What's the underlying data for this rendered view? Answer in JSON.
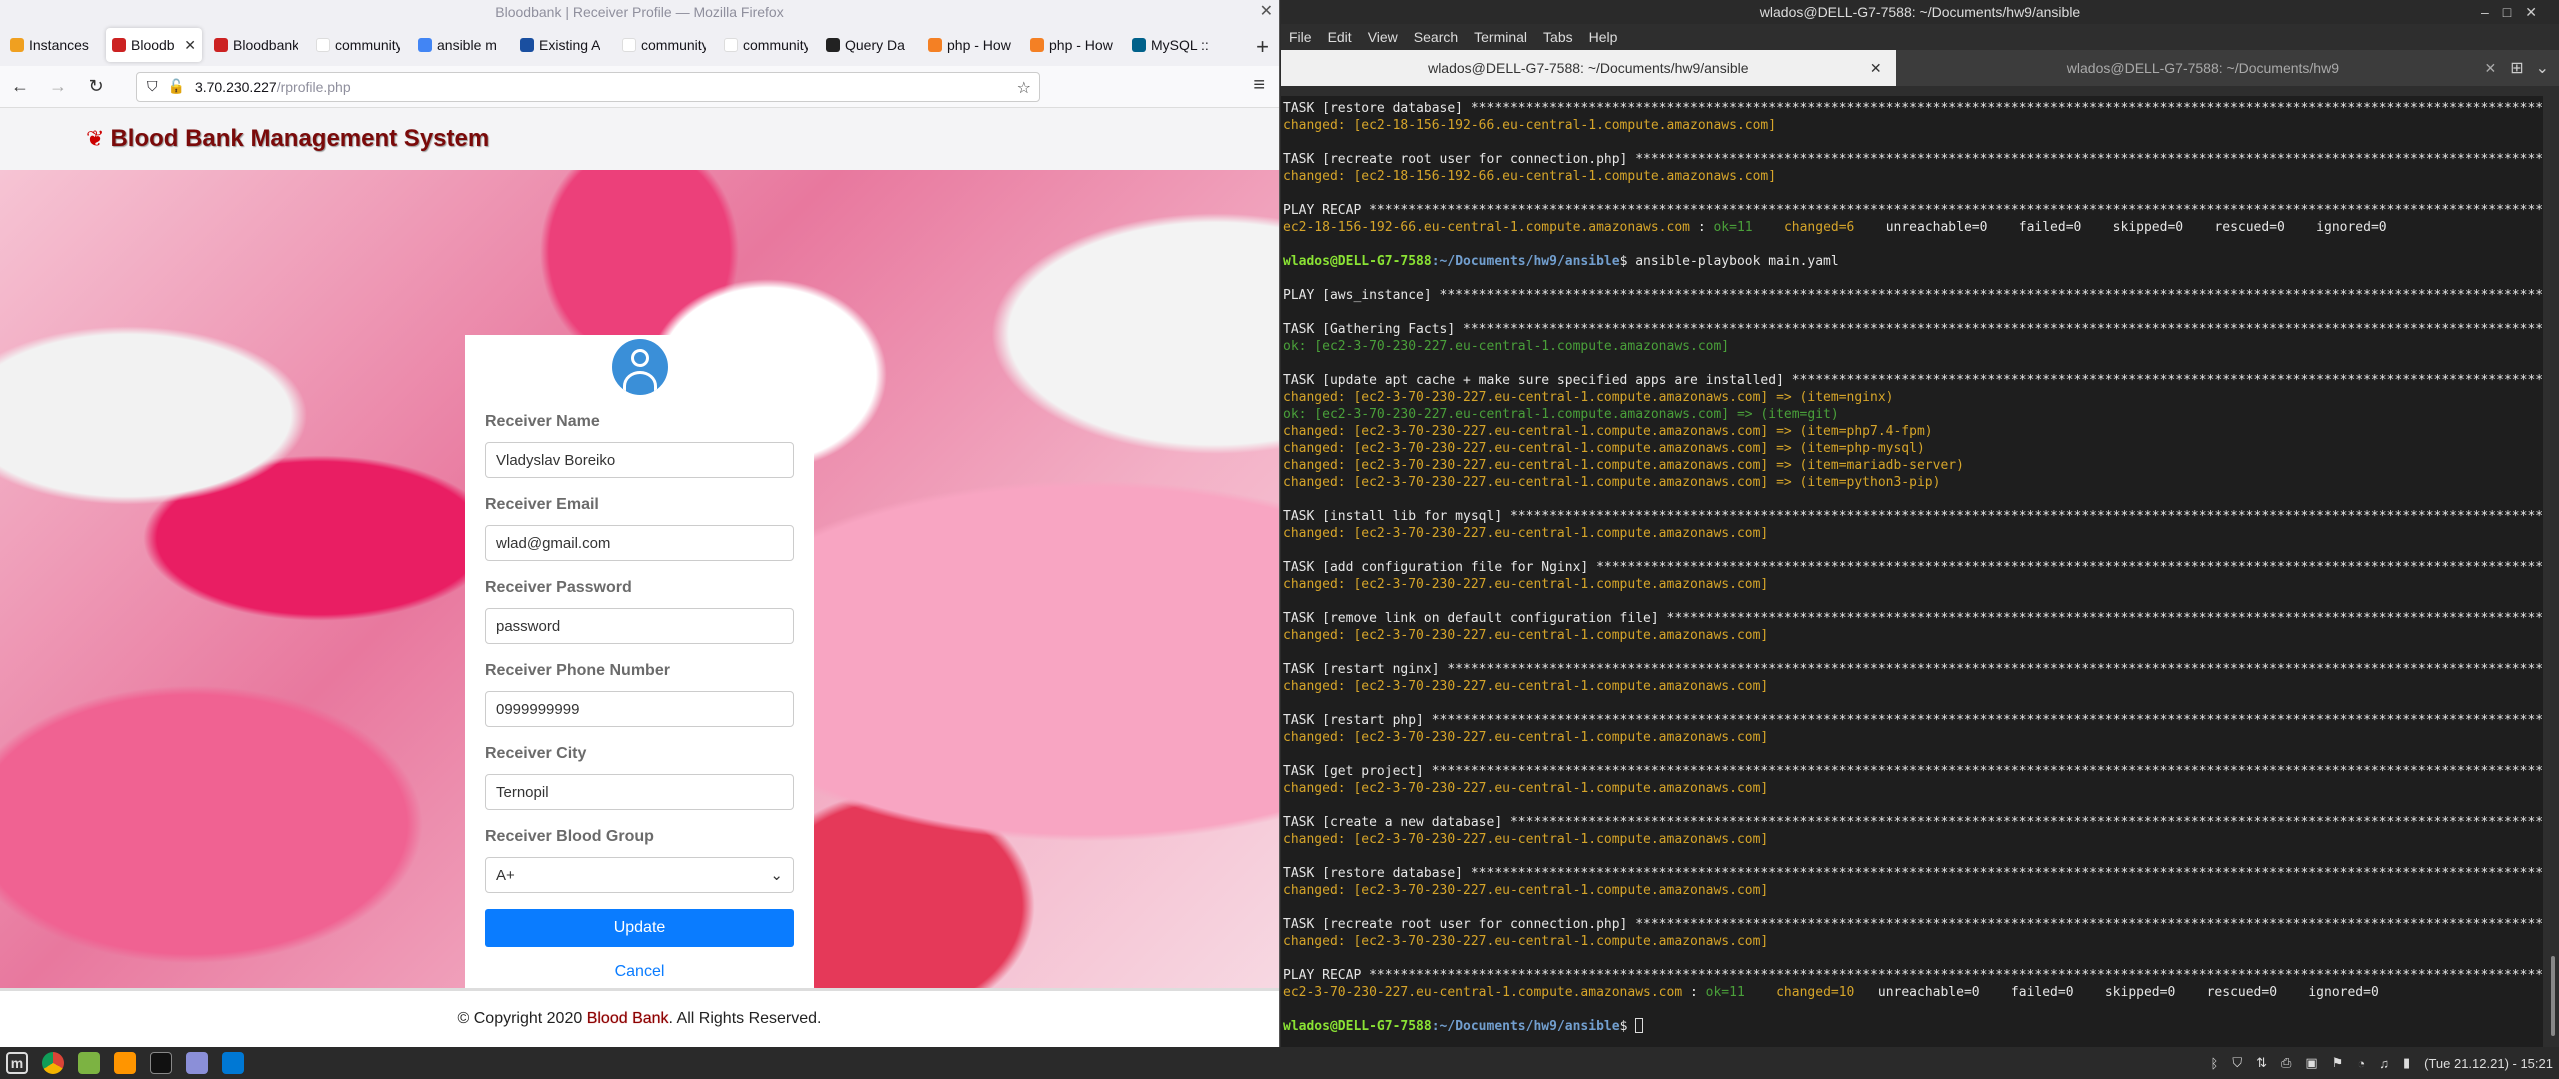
{
  "firefox": {
    "window_title": "Bloodbank | Receiver Profile — Mozilla Firefox",
    "tabs": [
      {
        "label": "Instances",
        "color": "#f0a020"
      },
      {
        "label": "Bloodb",
        "color": "#cc2222",
        "active": true
      },
      {
        "label": "Bloodbank",
        "color": "#cc2222"
      },
      {
        "label": "community.m",
        "color": "#ffffff"
      },
      {
        "label": "ansible m",
        "color": "#4285f4"
      },
      {
        "label": "Existing A",
        "color": "#1a4fa0"
      },
      {
        "label": "community.m",
        "color": "#ffffff"
      },
      {
        "label": "community.m",
        "color": "#ffffff"
      },
      {
        "label": "Query Da",
        "color": "#222222"
      },
      {
        "label": "php - How",
        "color": "#f48024"
      },
      {
        "label": "php - How",
        "color": "#f48024"
      },
      {
        "label": "MySQL :: ",
        "color": "#00618a"
      }
    ],
    "url_host": "3.70.230.227",
    "url_path": "/rprofile.php"
  },
  "site": {
    "title": "Blood Bank Management System",
    "form": {
      "fields": [
        {
          "label": "Receiver Name",
          "value": "Vladyslav Boreiko"
        },
        {
          "label": "Receiver Email",
          "value": "wlad@gmail.com"
        },
        {
          "label": "Receiver Password",
          "value": "password"
        },
        {
          "label": "Receiver Phone Number",
          "value": "0999999999"
        },
        {
          "label": "Receiver City",
          "value": "Ternopil"
        }
      ],
      "blood_group_label": "Receiver Blood Group",
      "blood_group_value": "A+",
      "update_label": "Update",
      "cancel_label": "Cancel"
    },
    "footer": {
      "prefix": "© Copyright 2020 ",
      "brand": "Blood Bank",
      "suffix": ". All Rights Reserved."
    }
  },
  "terminal": {
    "window_title": "wlados@DELL-G7-7588: ~/Documents/hw9/ansible",
    "menu": [
      "File",
      "Edit",
      "View",
      "Search",
      "Terminal",
      "Tabs",
      "Help"
    ],
    "tabs": [
      "wlados@DELL-G7-7588: ~/Documents/hw9/ansible",
      "wlados@DELL-G7-7588: ~/Documents/hw9"
    ],
    "lines": [
      {
        "t": "task",
        "s": "TASK [restore database] ******************************************************************************************************************************************************"
      },
      {
        "t": "changed",
        "s": "changed: [ec2-18-156-192-66.eu-central-1.compute.amazonaws.com]"
      },
      {
        "t": "blank",
        "s": ""
      },
      {
        "t": "task",
        "s": "TASK [recreate root user for connection.php] ****************************************************************************************************************************"
      },
      {
        "t": "changed",
        "s": "changed: [ec2-18-156-192-66.eu-central-1.compute.amazonaws.com]"
      },
      {
        "t": "blank",
        "s": ""
      },
      {
        "t": "task",
        "s": "PLAY RECAP *******************************************************************************************************************************************************************"
      },
      {
        "t": "recap1",
        "s": ""
      },
      {
        "t": "blank",
        "s": ""
      },
      {
        "t": "prompt",
        "s": "$ ansible-playbook main.yaml"
      },
      {
        "t": "blank",
        "s": ""
      },
      {
        "t": "task",
        "s": "PLAY [aws_instance] **********************************************************************************************************************************************************"
      },
      {
        "t": "blank",
        "s": ""
      },
      {
        "t": "task",
        "s": "TASK [Gathering Facts] *******************************************************************************************************************************************************"
      },
      {
        "t": "ok",
        "s": "ok: [ec2-3-70-230-227.eu-central-1.compute.amazonaws.com]"
      },
      {
        "t": "blank",
        "s": ""
      },
      {
        "t": "task",
        "s": "TASK [update apt cache + make sure specified apps are installed] *********************************************************************************************************"
      },
      {
        "t": "changed",
        "s": "changed: [ec2-3-70-230-227.eu-central-1.compute.amazonaws.com] => (item=nginx)"
      },
      {
        "t": "ok",
        "s": "ok: [ec2-3-70-230-227.eu-central-1.compute.amazonaws.com] => (item=git)"
      },
      {
        "t": "changed",
        "s": "changed: [ec2-3-70-230-227.eu-central-1.compute.amazonaws.com] => (item=php7.4-fpm)"
      },
      {
        "t": "changed",
        "s": "changed: [ec2-3-70-230-227.eu-central-1.compute.amazonaws.com] => (item=php-mysql)"
      },
      {
        "t": "changed",
        "s": "changed: [ec2-3-70-230-227.eu-central-1.compute.amazonaws.com] => (item=mariadb-server)"
      },
      {
        "t": "changed",
        "s": "changed: [ec2-3-70-230-227.eu-central-1.compute.amazonaws.com] => (item=python3-pip)"
      },
      {
        "t": "blank",
        "s": ""
      },
      {
        "t": "task",
        "s": "TASK [install lib for mysql] *************************************************************************************************************************************************"
      },
      {
        "t": "changed",
        "s": "changed: [ec2-3-70-230-227.eu-central-1.compute.amazonaws.com]"
      },
      {
        "t": "blank",
        "s": ""
      },
      {
        "t": "task",
        "s": "TASK [add configuration file for Nginx] **********************************************************************************************************************************"
      },
      {
        "t": "changed",
        "s": "changed: [ec2-3-70-230-227.eu-central-1.compute.amazonaws.com]"
      },
      {
        "t": "blank",
        "s": ""
      },
      {
        "t": "task",
        "s": "TASK [remove link on default configuration file] *************************************************************************************************************************"
      },
      {
        "t": "changed",
        "s": "changed: [ec2-3-70-230-227.eu-central-1.compute.amazonaws.com]"
      },
      {
        "t": "blank",
        "s": ""
      },
      {
        "t": "task",
        "s": "TASK [restart nginx] *********************************************************************************************************************************************************"
      },
      {
        "t": "changed",
        "s": "changed: [ec2-3-70-230-227.eu-central-1.compute.amazonaws.com]"
      },
      {
        "t": "blank",
        "s": ""
      },
      {
        "t": "task",
        "s": "TASK [restart php] ***********************************************************************************************************************************************************"
      },
      {
        "t": "changed",
        "s": "changed: [ec2-3-70-230-227.eu-central-1.compute.amazonaws.com]"
      },
      {
        "t": "blank",
        "s": ""
      },
      {
        "t": "task",
        "s": "TASK [get project] ***********************************************************************************************************************************************************"
      },
      {
        "t": "changed",
        "s": "changed: [ec2-3-70-230-227.eu-central-1.compute.amazonaws.com]"
      },
      {
        "t": "blank",
        "s": ""
      },
      {
        "t": "task",
        "s": "TASK [create a new database] *************************************************************************************************************************************************"
      },
      {
        "t": "changed",
        "s": "changed: [ec2-3-70-230-227.eu-central-1.compute.amazonaws.com]"
      },
      {
        "t": "blank",
        "s": ""
      },
      {
        "t": "task",
        "s": "TASK [restore database] ******************************************************************************************************************************************************"
      },
      {
        "t": "changed",
        "s": "changed: [ec2-3-70-230-227.eu-central-1.compute.amazonaws.com]"
      },
      {
        "t": "blank",
        "s": ""
      },
      {
        "t": "task",
        "s": "TASK [recreate root user for connection.php] ****************************************************************************************************************************"
      },
      {
        "t": "changed",
        "s": "changed: [ec2-3-70-230-227.eu-central-1.compute.amazonaws.com]"
      },
      {
        "t": "blank",
        "s": ""
      },
      {
        "t": "task",
        "s": "PLAY RECAP *******************************************************************************************************************************************************************"
      },
      {
        "t": "recap2",
        "s": ""
      },
      {
        "t": "blank",
        "s": ""
      },
      {
        "t": "prompt_end",
        "s": "$ "
      }
    ],
    "recap1": {
      "host": "ec2-18-156-192-66.eu-central-1.compute.amazonaws.com",
      "sep": " : ",
      "ok": "ok=11",
      "changed": "changed=6",
      "rest": "    unreachable=0    failed=0    skipped=0    rescued=0    ignored=0"
    },
    "recap2": {
      "host": "ec2-3-70-230-227.eu-central-1.compute.amazonaws.com",
      "sep": " : ",
      "ok": "ok=11",
      "changed": "changed=10",
      "rest": "   unreachable=0    failed=0    skipped=0    rescued=0    ignored=0"
    },
    "prompt_user": "wlados@DELL-G7-7588",
    "prompt_path": ":~/Documents/hw9/ansible"
  },
  "taskbar": {
    "clock": "(Tue 21.12.21) - 15:21"
  }
}
